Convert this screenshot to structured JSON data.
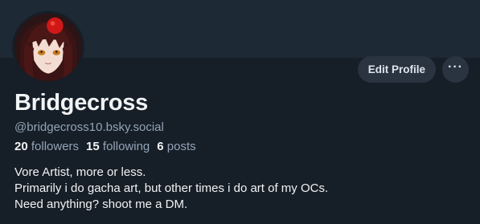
{
  "profile": {
    "display_name": "Bridgecross",
    "handle": "@bridgecross10.bsky.social",
    "stats": {
      "followers_count": "20",
      "followers_label": "followers",
      "following_count": "15",
      "following_label": "following",
      "posts_count": "6",
      "posts_label": "posts"
    },
    "bio_lines": [
      "Vore Artist, more or less.",
      "Primarily i do gacha art, but other times i do art of my OCs.",
      "Need anything? shoot me a DM."
    ]
  },
  "actions": {
    "edit_profile_label": "Edit Profile",
    "more_label": "···"
  },
  "icons": {
    "avatar": "anime-character-avatar",
    "more": "ellipsis-icon"
  },
  "colors": {
    "background": "#161e27",
    "banner": "#1e2936",
    "button_bg": "#2a3441",
    "text_primary": "#f1f3f5",
    "text_secondary": "#93a4b6"
  }
}
